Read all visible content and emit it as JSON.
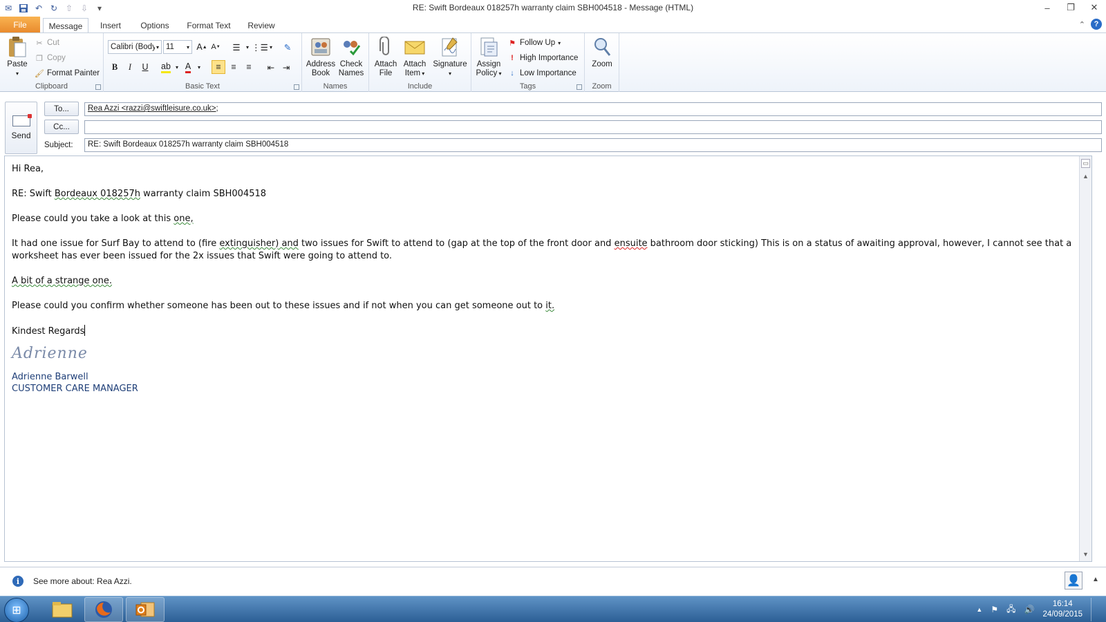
{
  "window": {
    "title": "RE: Swift Bordeaux  018257h warranty claim SBH004518  -  Message (HTML)",
    "min_glyph": "–",
    "max_glyph": "❐",
    "close_glyph": "✕"
  },
  "tabs": [
    "File",
    "Message",
    "Insert",
    "Options",
    "Format Text",
    "Review"
  ],
  "ribbon": {
    "clipboard": {
      "label": "Clipboard",
      "paste": "Paste",
      "cut": "Cut",
      "copy": "Copy",
      "format_painter": "Format Painter"
    },
    "basic_text": {
      "label": "Basic Text",
      "font": "Calibri (Body)",
      "size": "11",
      "bold": "B",
      "italic": "I",
      "underline": "U"
    },
    "names": {
      "label": "Names",
      "address_book_1": "Address",
      "address_book_2": "Book",
      "check_names_1": "Check",
      "check_names_2": "Names"
    },
    "include": {
      "label": "Include",
      "attach_file_1": "Attach",
      "attach_file_2": "File",
      "attach_item_1": "Attach",
      "attach_item_2": "Item",
      "signature": "Signature"
    },
    "tags": {
      "label": "Tags",
      "assign_policy_1": "Assign",
      "assign_policy_2": "Policy",
      "follow_up": "Follow Up",
      "high_importance": "High Importance",
      "low_importance": "Low Importance"
    },
    "zoom": {
      "label": "Zoom",
      "zoom": "Zoom"
    }
  },
  "header": {
    "send": "Send",
    "to_button": "To...",
    "cc_button": "Cc...",
    "subject_label": "Subject:",
    "to_value": "Rea Azzi <razzi@swiftleisure.co.uk>",
    "to_suffix": ";",
    "cc_value": "",
    "subject_value": "RE: Swift Bordeaux  018257h warranty claim SBH004518"
  },
  "body": {
    "greeting": "Hi Rea,",
    "ref_prefix": "RE: Swift ",
    "ref_word": "Bordeaux  018257h",
    "ref_suffix": " warranty claim SBH004518",
    "p1_prefix": "Please could you take a look at this ",
    "p1_word": "one,",
    "p2_a": "It had one issue for Surf Bay to attend to (fire ",
    "p2_b": "extinguisher)  and",
    "p2_c": " two issues for Swift to attend to (gap at the top of the front door and ",
    "p2_d": "ensuite",
    "p2_e": " bathroom door sticking) This is on a status of awaiting approval, however, I cannot see that a worksheet has ever been issued for the 2x issues that Swift were going to attend to.",
    "p3": "A bit of a strange one.",
    "p4_prefix": "Please could you confirm whether someone has been out to these issues and if not when you can get someone out to ",
    "p4_word": "it.",
    "closing": "Kindest Regards",
    "signature": "Adrienne",
    "sig_name": "Adrienne Barwell",
    "sig_title": "CUSTOMER CARE MANAGER"
  },
  "people": {
    "see_more": "See more about: Rea Azzi."
  },
  "taskbar": {
    "time": "16:14",
    "date": "24/09/2015"
  },
  "colors": {
    "file_tab": "#e8892c",
    "accent": "#2a6cc7",
    "signature_text": "#1f3f78"
  }
}
